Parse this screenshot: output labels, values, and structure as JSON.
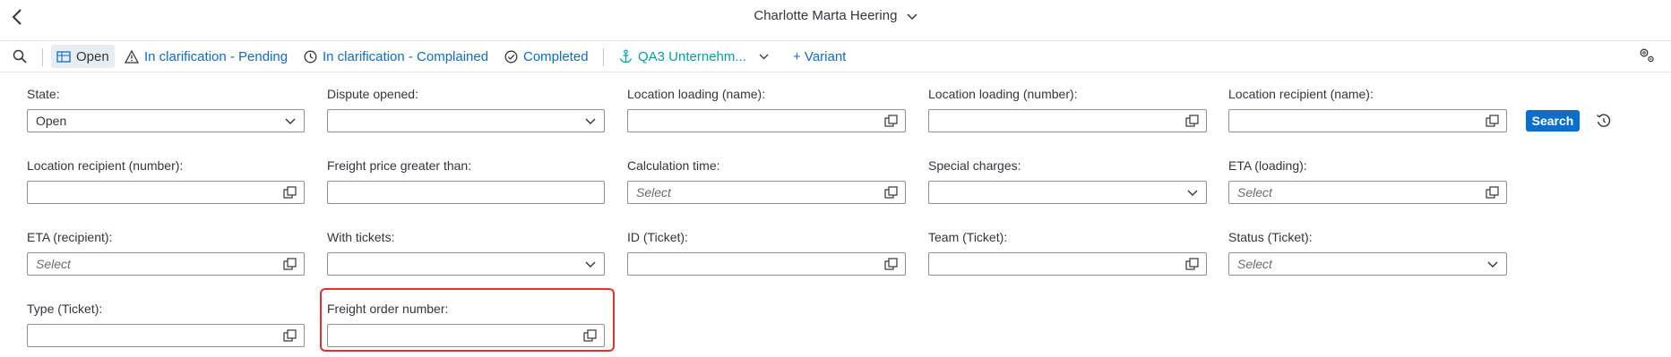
{
  "header": {
    "title": "Charlotte Marta Heering"
  },
  "toolbar": {
    "tabs": [
      {
        "label": "Open"
      },
      {
        "label": "In clarification - Pending"
      },
      {
        "label": "In clarification - Complained"
      },
      {
        "label": "Completed"
      }
    ],
    "variant_selector": "QA3 Unternehm...",
    "add_variant": "+ Variant"
  },
  "filters": {
    "state": {
      "label": "State:",
      "value": "Open"
    },
    "dispute_opened": {
      "label": "Dispute opened:",
      "value": ""
    },
    "location_loading_name": {
      "label": "Location loading (name):",
      "value": ""
    },
    "location_loading_number": {
      "label": "Location loading (number):",
      "value": ""
    },
    "location_recipient_name": {
      "label": "Location recipient (name):",
      "value": ""
    },
    "location_recipient_number": {
      "label": "Location recipient (number):",
      "value": ""
    },
    "freight_price_greater": {
      "label": "Freight price greater than:",
      "value": ""
    },
    "calculation_time": {
      "label": "Calculation time:",
      "placeholder": "Select"
    },
    "special_charges": {
      "label": "Special charges:",
      "value": ""
    },
    "eta_loading": {
      "label": "ETA (loading):",
      "placeholder": "Select"
    },
    "eta_recipient": {
      "label": "ETA (recipient):",
      "placeholder": "Select"
    },
    "with_tickets": {
      "label": "With tickets:",
      "value": ""
    },
    "id_ticket": {
      "label": "ID (Ticket):",
      "value": ""
    },
    "team_ticket": {
      "label": "Team (Ticket):",
      "value": ""
    },
    "status_ticket": {
      "label": "Status (Ticket):",
      "placeholder": "Select"
    },
    "type_ticket": {
      "label": "Type (Ticket):",
      "value": ""
    },
    "freight_order_number": {
      "label": "Freight order number:",
      "value": ""
    }
  },
  "actions": {
    "search_label": "Search"
  },
  "colors": {
    "accent": "#0a6ed1",
    "teal": "#00a3a0",
    "highlight": "#e0322f"
  }
}
